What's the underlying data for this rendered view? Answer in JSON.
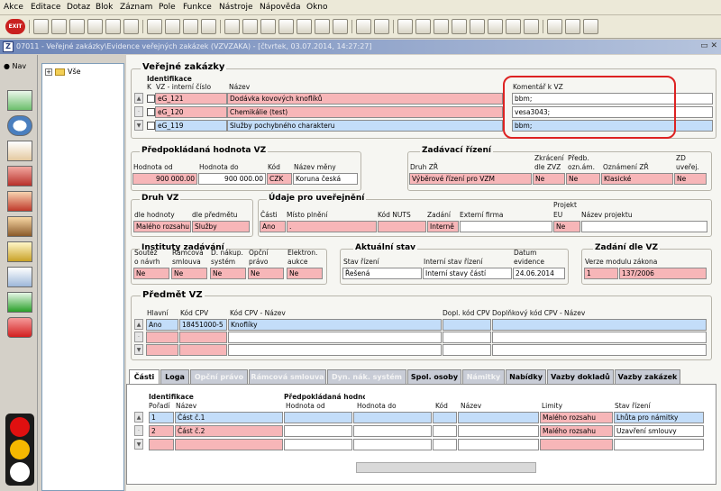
{
  "menu": [
    "Akce",
    "Editace",
    "Dotaz",
    "Blok",
    "Záznam",
    "Pole",
    "Funkce",
    "Nástroje",
    "Nápověda",
    "Okno"
  ],
  "toolbar": {
    "exit_label": "EXIT",
    "buttons": [
      "new",
      "copy",
      "save",
      "delete",
      "search",
      "filter",
      "print",
      "preview",
      "export",
      "help",
      "calc"
    ]
  },
  "window": {
    "title": "07011 - Veřejné zakázky\\Evidence veřejných zakázek (VZVZAKA) - [čtvrtek, 03.07.2014, 14:27:27]",
    "controls": "▭ ✕"
  },
  "nav": {
    "label": "Nav",
    "tree_root": "Vše"
  },
  "vz": {
    "title": "Veřejné zakázky",
    "subtitle": "Identifikace",
    "col_k": "K",
    "col_id": "VZ - interní číslo",
    "col_name": "Název",
    "col_comment": "Komentář k VZ",
    "rows": [
      {
        "id": "eG_121",
        "name": "Dodávka kovových knoflíků",
        "comment": "bbm;"
      },
      {
        "id": "eG_120",
        "name": "Chemikálie (test)",
        "comment": "vesa3043;"
      },
      {
        "id": "eG_119",
        "name": "Služby pochybného charakteru",
        "comment": "bbm;"
      }
    ]
  },
  "hodnota": {
    "title": "Předpokládaná hodnota VZ",
    "od_label": "Hodnota od",
    "do_label": "Hodnota do",
    "kod_label": "Kód",
    "mena_label": "Název měny",
    "od": "900 000.00",
    "do": "900 000.00",
    "kod": "CZK",
    "mena": "Koruna česká"
  },
  "zadavaci": {
    "title": "Zadávací řízení",
    "druh_label": "Druh ZŘ",
    "zkr_label1": "Zkrácení",
    "zkr_label2": "dle ZVZ",
    "predb_label1": "Předb.",
    "predb_label2": "ozn.ám.",
    "ozn_label": "Oznámení ZŘ",
    "zd_label1": "ZD",
    "zd_label2": "uveřej.",
    "druh": "Výběrové řízení pro VZM",
    "zkr": "Ne",
    "predb": "Ne",
    "ozn": "Klasické",
    "zd": "Ne"
  },
  "druhvz": {
    "title": "Druh VZ",
    "hodnoty_label": "dle hodnoty",
    "predmetu_label": "dle předmětu",
    "hodnoty": "Malého rozsahu",
    "predmetu": "Služby"
  },
  "udaje": {
    "title": "Údaje pro uveřejnění",
    "casti_label": "Části",
    "misto_label": "Místo plnění",
    "nuts_label": "Kód NUTS",
    "zadani_label": "Zadání",
    "firma_label": "Externí firma",
    "eu_label1": "Projekt",
    "eu_label2": "EU",
    "projekt_label": "Název projektu",
    "casti": "Ano",
    "misto": ".",
    "nuts": "",
    "zadani": "Interně",
    "firma": "",
    "eu": "Ne",
    "projekt": ""
  },
  "instituty": {
    "title": "Instituty zadávání",
    "l1a": "Soutěž",
    "l1b": "o návrh",
    "l2a": "Rámcová",
    "l2b": "smlouva",
    "l3a": "D. nákup.",
    "l3b": "systém",
    "l4a": "Opční",
    "l4b": "právo",
    "l5a": "Elektron.",
    "l5b": "aukce",
    "v1": "Ne",
    "v2": "Ne",
    "v3": "Ne",
    "v4": "Ne",
    "v5": "Ne"
  },
  "stav": {
    "title": "Aktuální stav",
    "stav_label": "Stav řízení",
    "int_label": "Interní stav řízení",
    "datum_label1": "Datum",
    "datum_label2": "evidence",
    "stav": "Řešená",
    "int": "Interní stavy částí",
    "datum": "24.06.2014"
  },
  "zadani": {
    "title": "Zadání dle VZ",
    "verze_label": "Verze modulu zákona",
    "verze": "1",
    "zakon": "137/2006"
  },
  "predmet": {
    "title": "Předmět VZ",
    "hlavni_label": "Hlavní",
    "kod_label": "Kód CPV",
    "nazev_label": "Kód CPV - Název",
    "dopl_label": "Dopl. kód CPV",
    "dopl_nazev_label": "Doplňkový kód CPV - Název",
    "rows": [
      {
        "hlavni": "Ano",
        "kod": "18451000-5",
        "nazev": "Knoflíky"
      }
    ]
  },
  "tabs": [
    "Části",
    "Loga",
    "Opční právo",
    "Rámcová smlouva",
    "Dyn. nák. systém",
    "Spol. osoby",
    "Námitky",
    "Nabídky",
    "Vazby dokladů",
    "Vazby zakázek"
  ],
  "casti": {
    "ident_label": "Identifikace",
    "poradi_label": "Pořadí",
    "nazev_label": "Název",
    "hodnota_title": "Předpokládaná hodnota",
    "od_label": "Hodnota od",
    "do_label": "Hodnota do",
    "kod_label": "Kód",
    "mena_label": "Název",
    "limity_label": "Limity",
    "stav_label": "Stav řízení",
    "rows": [
      {
        "poradi": "1",
        "nazev": "Část č.1",
        "limity": "Malého rozsahu",
        "stav": "Lhůta pro námitky"
      },
      {
        "poradi": "2",
        "nazev": "Část č.2",
        "limity": "Malého rozsahu",
        "stav": "Uzavření smlouvy"
      }
    ]
  },
  "colors": {
    "pink": "#f7b6b8",
    "blue": "#c3ddf9",
    "highlight": "#d22222"
  }
}
